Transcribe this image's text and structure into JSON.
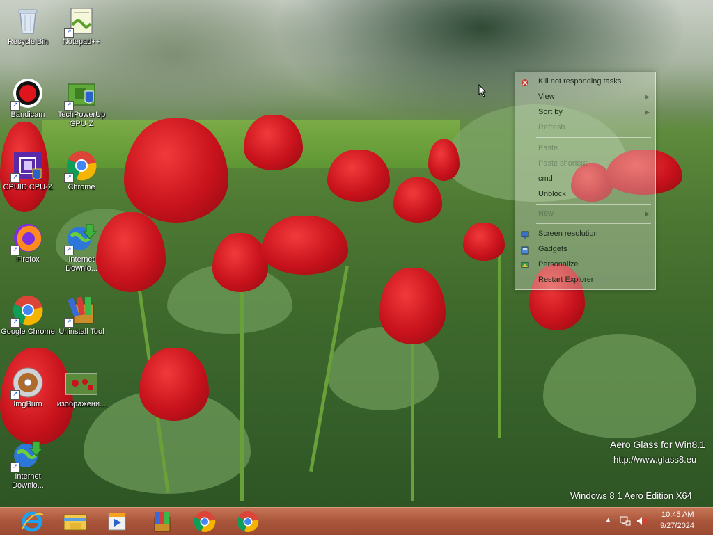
{
  "desktop_icons": [
    {
      "label": "Recycle Bin"
    },
    {
      "label": "Notepad++"
    },
    {
      "label": "Bandicam"
    },
    {
      "label_line1": "TechPowerUp",
      "label_line2": "GPU-Z"
    },
    {
      "label": "CPUID CPU-Z"
    },
    {
      "label": "Chrome"
    },
    {
      "label": "Firefox"
    },
    {
      "label_line1": "Internet",
      "label_line2": "Downlo..."
    },
    {
      "label": "Google Chrome"
    },
    {
      "label": "Uninstall Tool"
    },
    {
      "label": "ImgBurn"
    },
    {
      "label": "изображени..."
    },
    {
      "label_line1": "Internet",
      "label_line2": "Downlo..."
    }
  ],
  "context_menu": {
    "items": [
      {
        "label": "Kill not responding tasks",
        "enabled": true,
        "icon": "kill-tasks-icon"
      },
      {
        "label": "View",
        "enabled": true,
        "submenu": true
      },
      {
        "label": "Sort by",
        "enabled": true,
        "submenu": true
      },
      {
        "label": "Refresh",
        "enabled": false
      },
      {
        "label": "Paste",
        "enabled": false
      },
      {
        "label": "Paste shortcut",
        "enabled": false
      },
      {
        "label": "cmd",
        "enabled": true
      },
      {
        "label": "Unblock",
        "enabled": true
      },
      {
        "label": "New",
        "enabled": false,
        "submenu": true
      },
      {
        "label": "Screen resolution",
        "enabled": true,
        "icon": "screen-resolution-icon"
      },
      {
        "label": "Gadgets",
        "enabled": true,
        "icon": "gadgets-icon"
      },
      {
        "label": "Personalize",
        "enabled": true,
        "icon": "personalize-icon"
      },
      {
        "label": "Restart Explorer",
        "enabled": true
      }
    ]
  },
  "watermark": {
    "line1": "Aero Glass for Win8.1",
    "line2": "http://www.glass8.eu",
    "edition": "Windows 8.1 Aero Edition X64"
  },
  "taskbar": {
    "pinned": [
      "internet-explorer-icon",
      "file-explorer-icon",
      "media-player-icon",
      "winrar-icon",
      "chrome-icon",
      "chrome-icon"
    ],
    "tray": {
      "up_arrow": "▲",
      "time": "10:45 AM",
      "date": "9/27/2024"
    }
  },
  "colors": {
    "taskbar": "#a9553b",
    "accent_red": "#c8121c"
  }
}
